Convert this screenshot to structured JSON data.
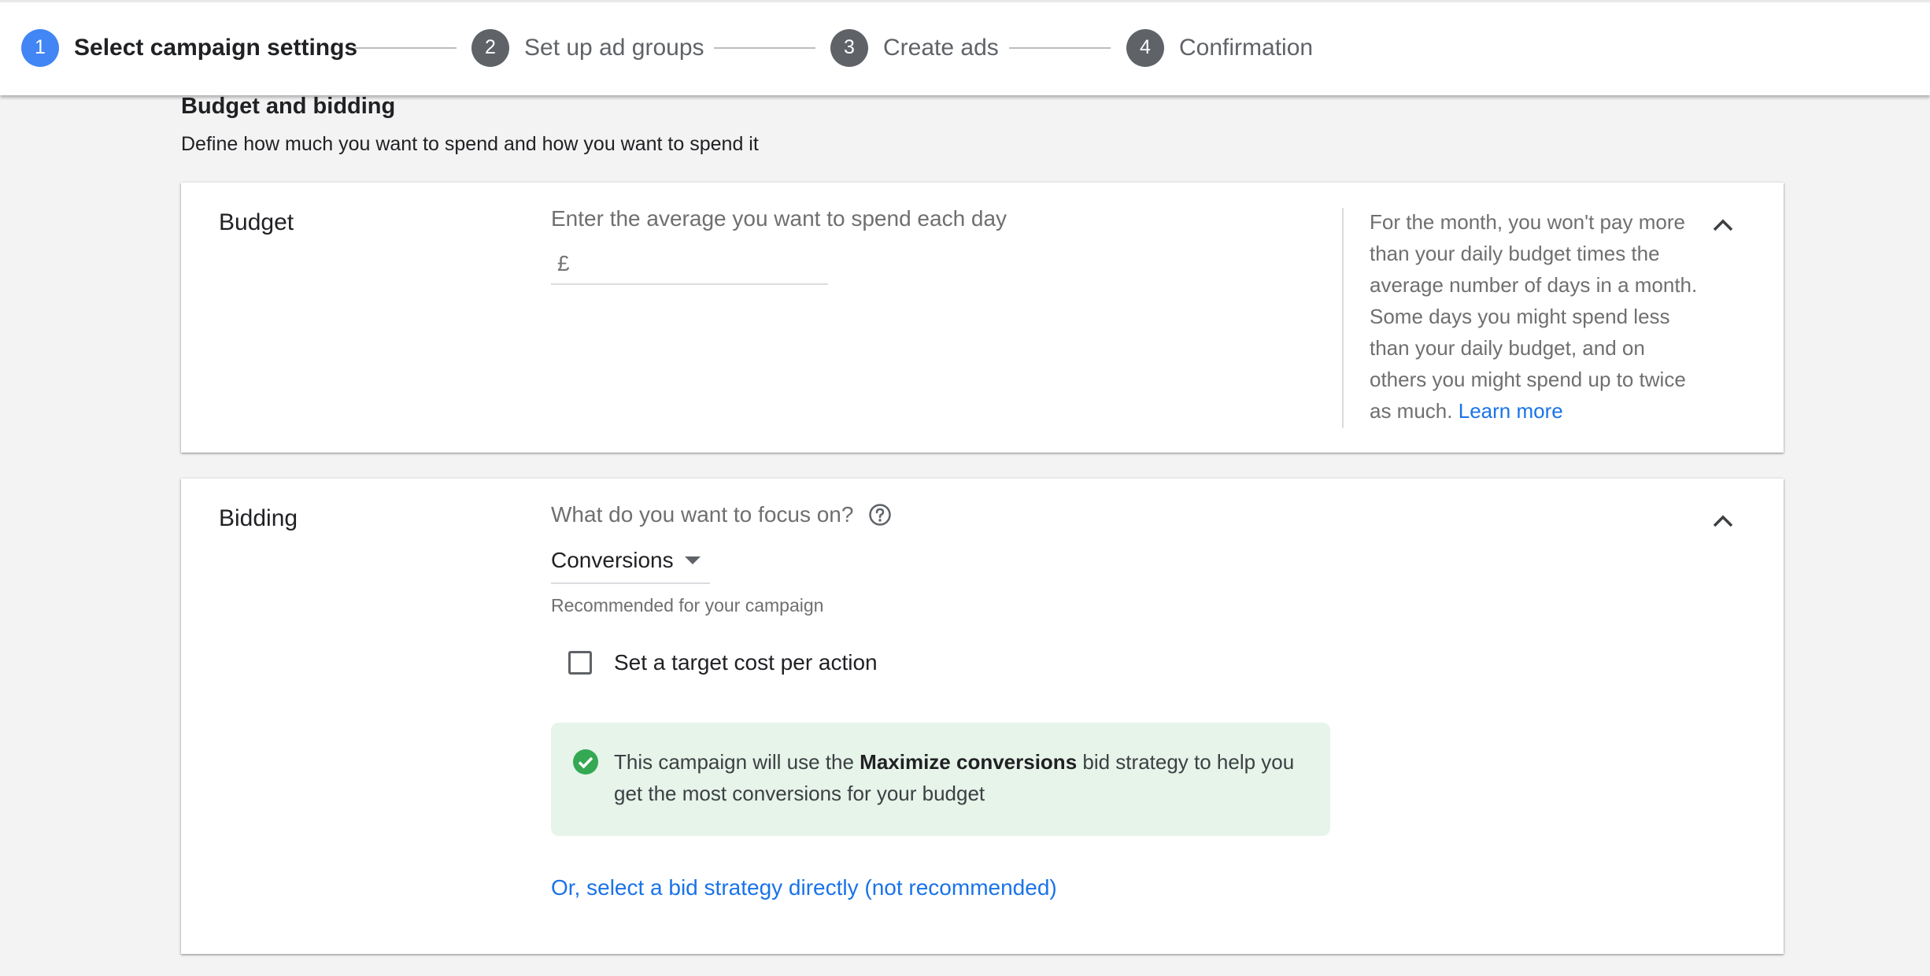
{
  "stepper": {
    "steps": [
      {
        "number": "1",
        "label": "Select campaign settings"
      },
      {
        "number": "2",
        "label": "Set up ad groups"
      },
      {
        "number": "3",
        "label": "Create ads"
      },
      {
        "number": "4",
        "label": "Confirmation"
      }
    ],
    "active_step": 1
  },
  "section": {
    "title": "Budget and bidding",
    "subtitle": "Define how much you want to spend and how you want to spend it"
  },
  "budget": {
    "title": "Budget",
    "prompt": "Enter the average you want to spend each day",
    "currency_symbol": "£",
    "input_value": "",
    "help_text": "For the month, you won't pay more than your daily budget times the average number of days in a month. Some days you might spend less than your daily budget, and on others you might spend up to twice as much.",
    "learn_more": "Learn more"
  },
  "bidding": {
    "title": "Bidding",
    "focus_question": "What do you want to focus on?",
    "focus_value": "Conversions",
    "recommended_note": "Recommended for your campaign",
    "target_cpa_label": "Set a target cost per action",
    "target_cpa_checked": false,
    "info_prefix": "This campaign will use the",
    "info_strategy": "Maximize conversions",
    "info_suffix": "bid strategy to help you get the most conversions for your budget",
    "select_strategy_link": "Or, select a bid strategy directly (not recommended)"
  },
  "colors": {
    "accent": "#4285f4",
    "link": "#1a73e8",
    "success_bg": "#e6f4ea",
    "success_icon": "#34a853",
    "step_inactive": "#5f6368"
  }
}
